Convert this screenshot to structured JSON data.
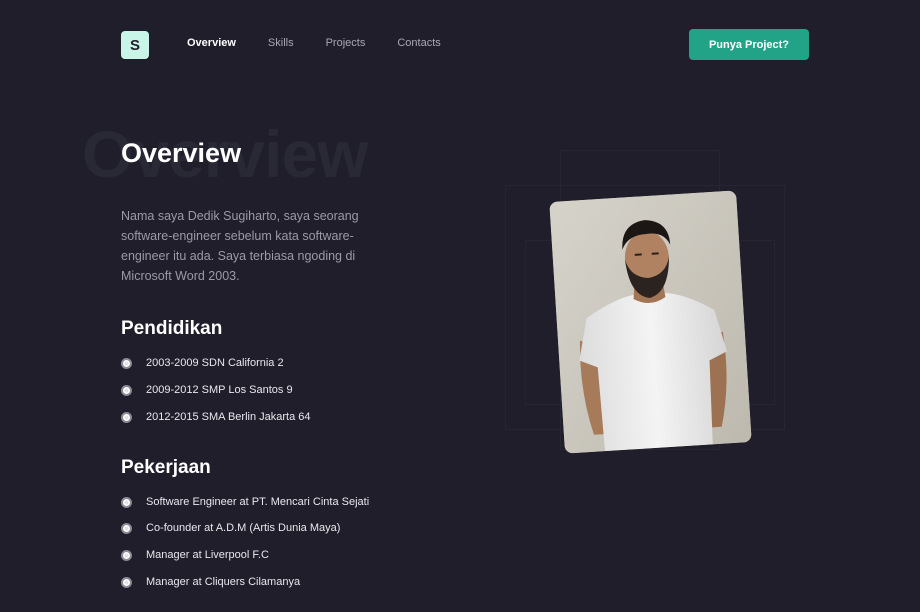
{
  "header": {
    "logo_letter": "S",
    "nav": [
      {
        "label": "Overview",
        "active": true
      },
      {
        "label": "Skills",
        "active": false
      },
      {
        "label": "Projects",
        "active": false
      },
      {
        "label": "Contacts",
        "active": false
      }
    ],
    "cta_label": "Punya Project?"
  },
  "hero": {
    "ghost_title": "Overview",
    "title": "Overview",
    "bio": "Nama saya Dedik Sugiharto, saya seorang software-engineer sebelum kata software-engineer itu ada. Saya terbiasa ngoding di Microsoft Word 2003."
  },
  "education": {
    "title": "Pendidikan",
    "items": [
      "2003-2009 SDN California 2",
      "2009-2012 SMP Los Santos 9",
      "2012-2015 SMA Berlin Jakarta 64"
    ]
  },
  "work": {
    "title": "Pekerjaan",
    "items": [
      "Software Engineer at PT. Mencari Cinta Sejati",
      "Co-founder at A.D.M (Artis Dunia Maya)",
      "Manager at Liverpool F.C",
      "Manager at Cliquers Cilamanya"
    ]
  },
  "colors": {
    "background": "#1f1e2a",
    "accent": "#22a388",
    "logo_bg": "#c9f5e8"
  }
}
